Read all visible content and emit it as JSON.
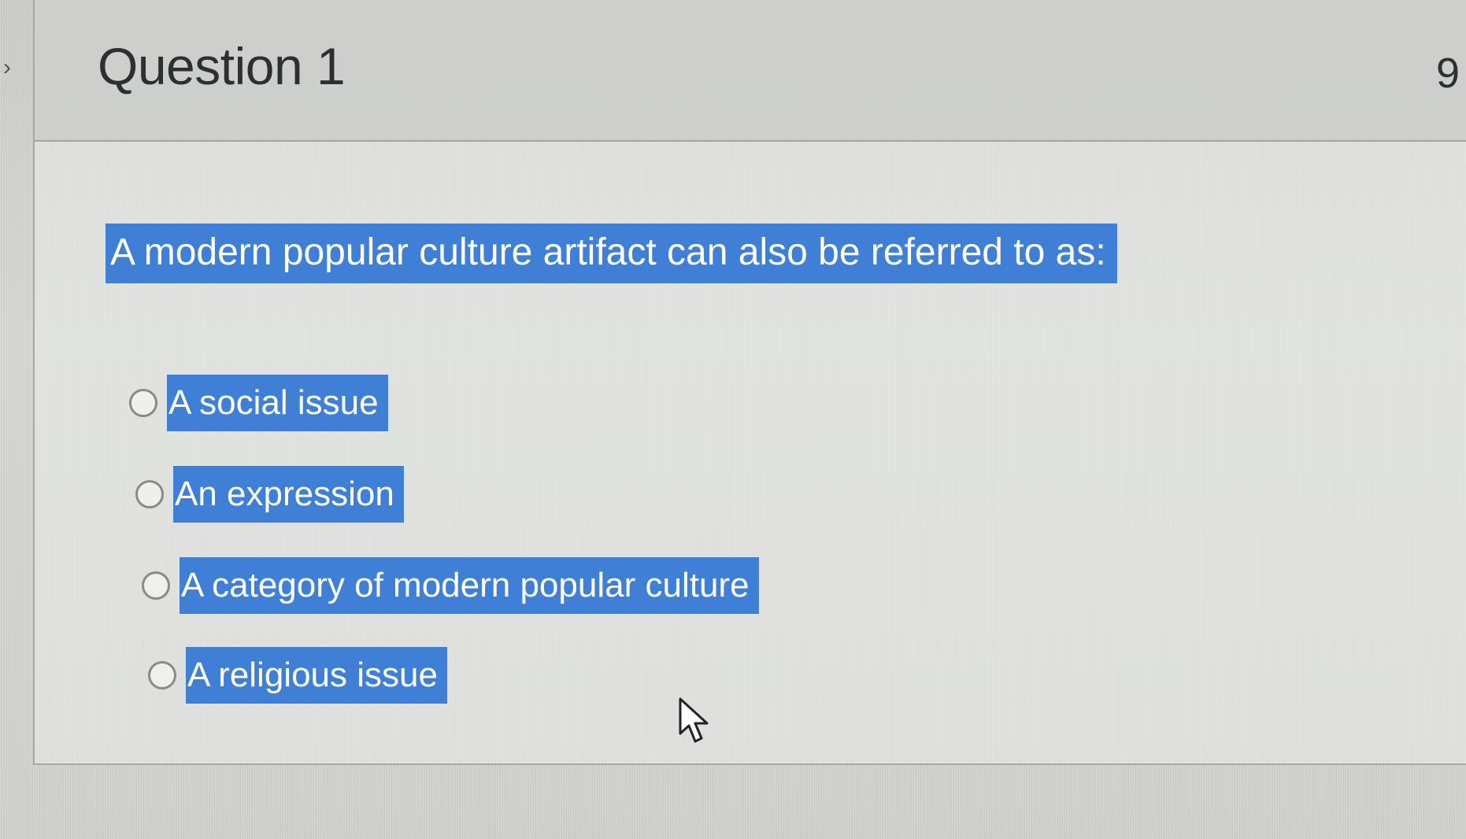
{
  "question": {
    "title": "Question 1",
    "points_partial": "9",
    "prompt": "A modern popular culture artifact can also be referred to as:",
    "answers": [
      {
        "label": "A social issue"
      },
      {
        "label": "An expression"
      },
      {
        "label": "A category of modern popular culture"
      },
      {
        "label": "A religious issue"
      }
    ]
  },
  "colors": {
    "highlight": "#3f7fd6",
    "background": "#cfd0ce",
    "text": "#2e2f31"
  },
  "icons": {
    "collapse": "chevron-right-icon",
    "pointer": "mouse-cursor-icon",
    "answer_option": "radio-button-icon"
  }
}
